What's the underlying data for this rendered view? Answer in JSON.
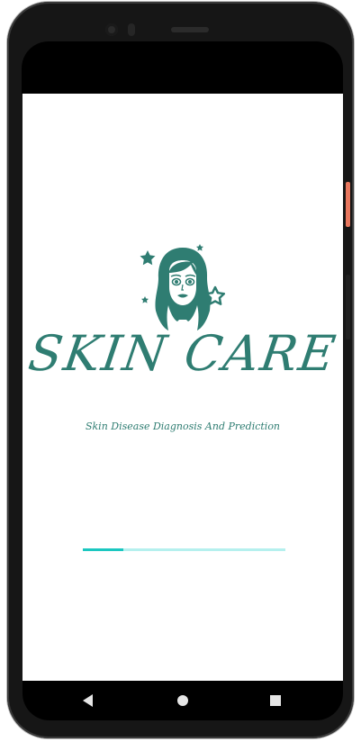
{
  "app": {
    "title": "SKIN CARE",
    "tagline": "Skin Disease Diagnosis And Prediction"
  },
  "logo": {
    "icon": "woman-face-with-stars-icon",
    "color": "#2f7d72"
  },
  "progress": {
    "value": 0.2,
    "fill_color": "#1bc7c0",
    "track_color": "#b5f0ee"
  },
  "nav": {
    "back_icon": "back-triangle-icon",
    "home_icon": "home-circle-icon",
    "recents_icon": "recents-square-icon"
  },
  "device": {
    "power_button_color": "#e8775e"
  }
}
